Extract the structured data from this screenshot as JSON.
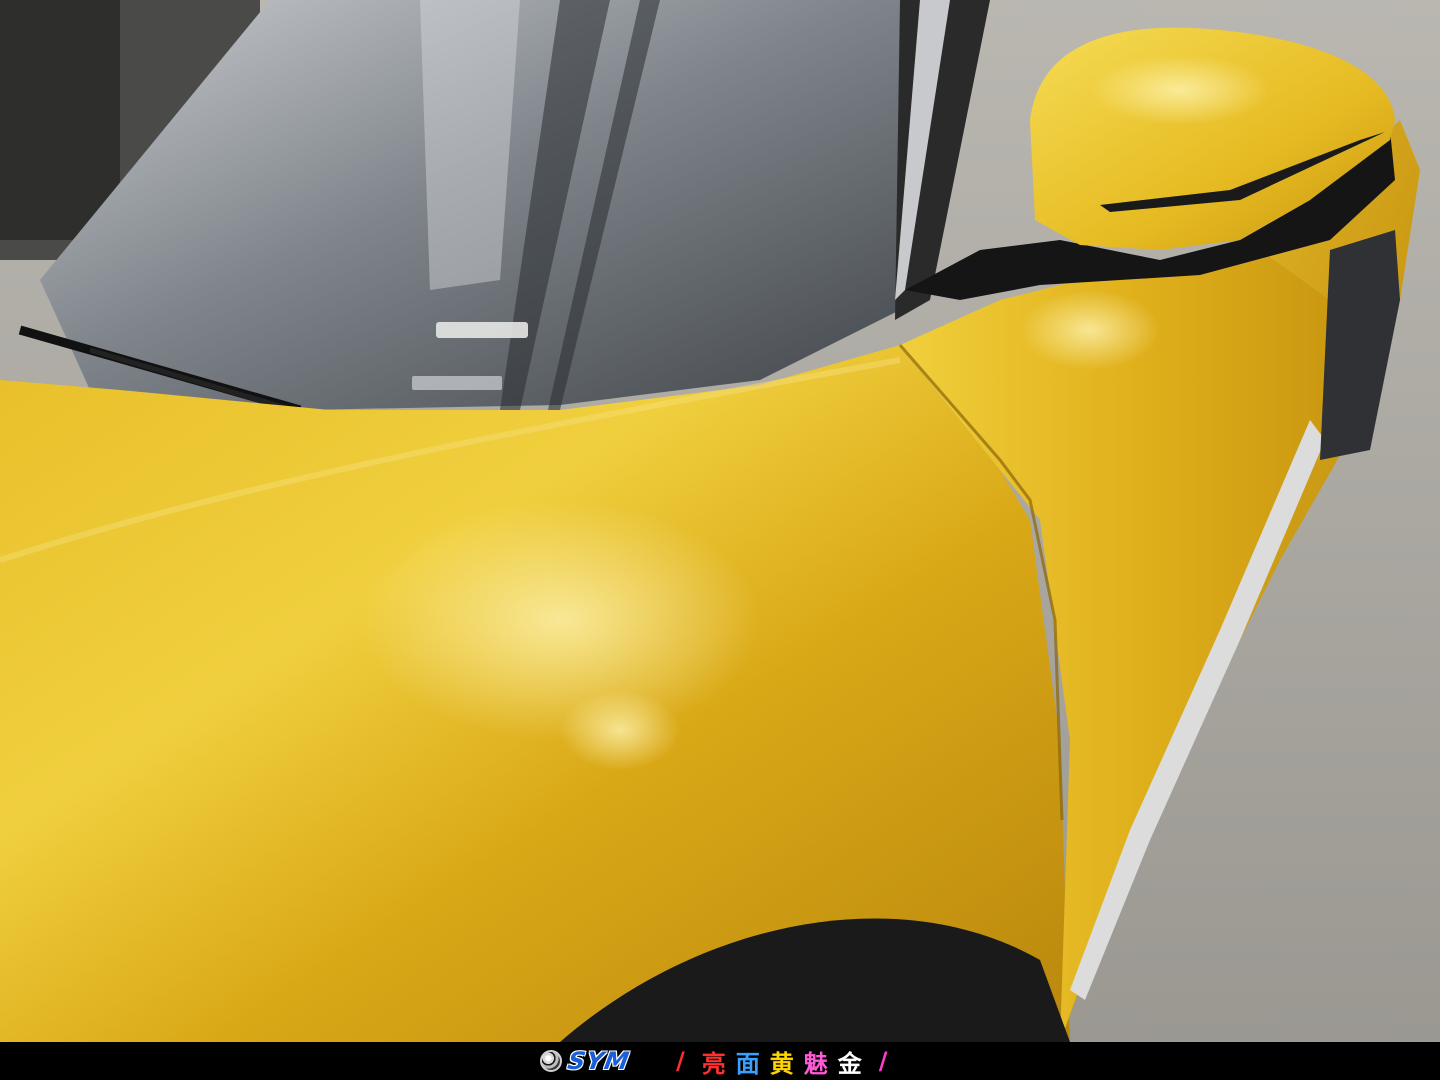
{
  "photo": {
    "subject": "car-hood-fender-mirror-windshield",
    "colors": {
      "paint_base": "#e2b21a",
      "paint_light": "#f2d548",
      "paint_dark": "#b07f0a",
      "glass": "#5a5f66",
      "ground": "#a9a7a0",
      "trim": "#d8d8d8",
      "black_trim": "#151515"
    }
  },
  "caption_bar": {
    "brand_text": "SYM",
    "brand_color": "#1a5fd6",
    "left_separator": "/",
    "right_separator": "/",
    "separator_colors": [
      "#ff2d2d",
      "#ff3bd0"
    ],
    "title_chars": [
      "亮",
      "面",
      "黄",
      "魅",
      "金"
    ],
    "title_colors": [
      "#ff3030",
      "#3aa0ff",
      "#ffd400",
      "#ff5ad6",
      "#ffffff"
    ]
  }
}
